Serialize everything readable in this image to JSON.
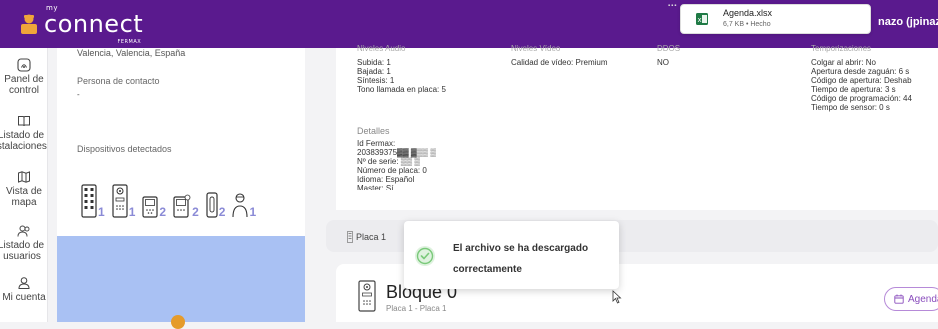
{
  "header": {
    "logo_small": "my",
    "logo_text": "connect",
    "logo_brand": "FERMAX",
    "user_partial": "nazo (jpinazo"
  },
  "download": {
    "filename": "Agenda.xlsx",
    "meta": "6,7 KB • Hecho"
  },
  "sidebar": {
    "items": [
      {
        "label1": "Panel de",
        "label2": "control",
        "icon": "dashboard-icon"
      },
      {
        "label1": "Listado de",
        "label2": "instalaciones",
        "icon": "book-icon"
      },
      {
        "label1": "Vista de",
        "label2": "mapa",
        "icon": "map-icon"
      },
      {
        "label1": "Listado de",
        "label2": "usuarios",
        "icon": "users-icon"
      },
      {
        "label1": "Mi cuenta",
        "label2": "",
        "icon": "user-icon"
      }
    ]
  },
  "left": {
    "address": "Valencia, Valencia, España",
    "contact_title": "Persona de contacto",
    "contact_value": "-",
    "devices_title": "Dispositivos detectados",
    "device_counts": [
      "1",
      "1",
      "2",
      "2",
      "2",
      "1"
    ]
  },
  "details": {
    "col1_header": "Niveles Audio",
    "col1": [
      "Subida: 1",
      "Bajada: 1",
      "Síntesis: 1",
      "Tono llamada en placa: 5"
    ],
    "col2_header": "Niveles Vídeo",
    "col2": [
      "Calidad de vídeo: Premium"
    ],
    "col3_header": "DDOS",
    "col3": [
      "NO"
    ],
    "col4_header": "Temporizaciones",
    "col4": [
      "Colgar al abrir: No",
      "Apertura desde zaguán: 6 s",
      "Código de apertura: Deshab",
      "Tiempo de apertura: 3 s",
      "Código de programación: 44",
      "Tiempo de sensor: 0 s"
    ],
    "detalles_title": "Detalles",
    "detalles": [
      "Id Fermax:",
      "203839375▓▓ ▓▒▒ ▒",
      "Nº de serie:   ▒▒ ▒",
      "Número de placa: 0",
      "Idioma: Español",
      "Master: Sí"
    ]
  },
  "placa_bar": {
    "label": "Placa 1"
  },
  "toast": {
    "line1": "El archivo se ha descargado",
    "line2": "correctamente"
  },
  "bloque": {
    "title": "Bloque 0",
    "subtitle": "Placa 1 - Placa 1",
    "agenda_button": "Agenda"
  },
  "colors": {
    "brand": "#5a1a8e",
    "accent": "#8a8ad6",
    "success": "#7ac97a"
  }
}
